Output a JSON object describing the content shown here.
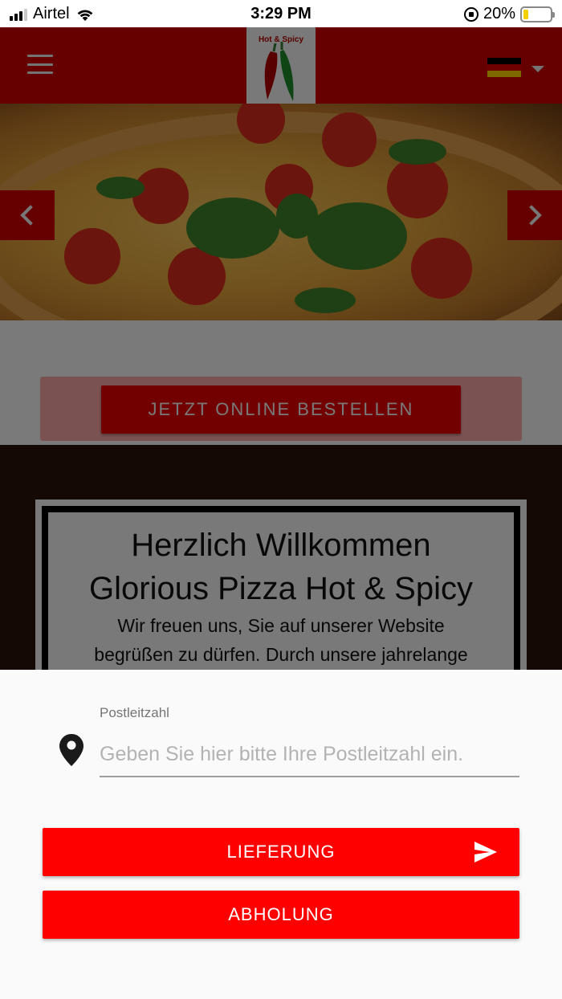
{
  "status_bar": {
    "carrier": "Airtel",
    "time": "3:29 PM",
    "battery": "20%",
    "battery_level": 0.2
  },
  "header": {
    "logo_text": "Hot & Spicy",
    "language_flag": "germany-flag-icon"
  },
  "order": {
    "button_label": "JETZT ONLINE BESTELLEN"
  },
  "welcome": {
    "title_line1": "Herzlich Willkommen",
    "title_line2": "Glorious Pizza Hot & Spicy",
    "body_line1": "Wir freuen uns, Sie auf unserer Website",
    "body_line2": "begrüßen zu dürfen. Durch unsere jahrelange"
  },
  "sheet": {
    "plz_label": "Postleitzahl",
    "plz_placeholder": "Geben Sie hier bitte Ihre Postleitzahl ein.",
    "plz_value": "",
    "delivery_label": "LIEFERUNG",
    "pickup_label": "ABHOLUNG"
  },
  "colors": {
    "header_red": "#cc0000",
    "button_red": "#ff0000",
    "battery_yellow": "#f5d000"
  }
}
